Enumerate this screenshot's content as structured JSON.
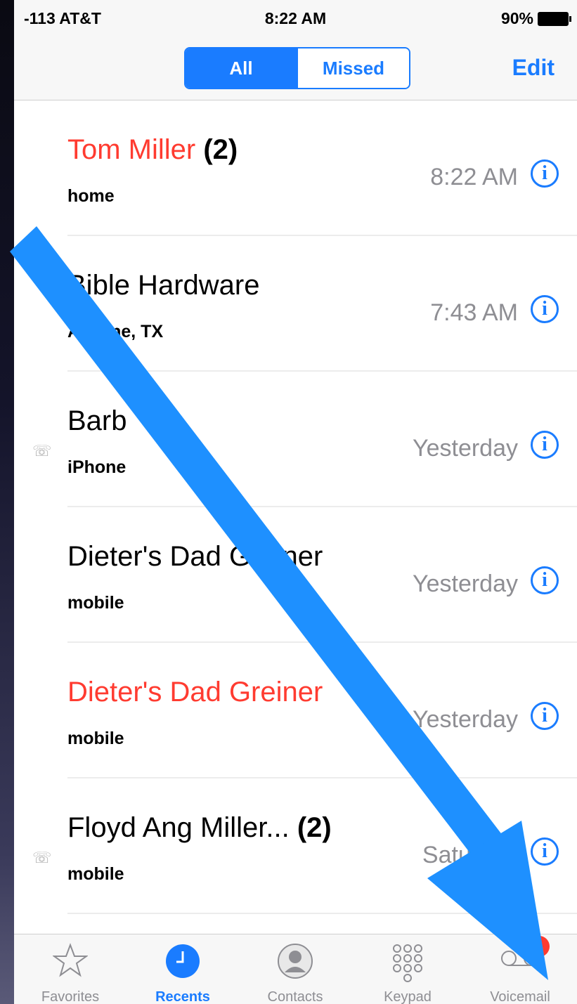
{
  "status_bar": {
    "signal": "-113 AT&T",
    "time": "8:22 AM",
    "battery": "90%"
  },
  "nav": {
    "segments": [
      "All",
      "Missed"
    ],
    "edit": "Edit"
  },
  "calls": [
    {
      "name": "Tom Miller",
      "count": "(2)",
      "sub": "home",
      "time": "8:22 AM",
      "missed": true,
      "outgoing": false
    },
    {
      "name": "Bible Hardware",
      "count": "",
      "sub": "Abilene, TX",
      "time": "7:43 AM",
      "missed": false,
      "outgoing": false
    },
    {
      "name": "Barb",
      "count": "",
      "sub": "iPhone",
      "time": "Yesterday",
      "missed": false,
      "outgoing": true
    },
    {
      "name": "Dieter's Dad Greiner",
      "count": "",
      "sub": "mobile",
      "time": "Yesterday",
      "missed": false,
      "outgoing": false
    },
    {
      "name": "Dieter's Dad Greiner",
      "count": "",
      "sub": "mobile",
      "time": "Yesterday",
      "missed": true,
      "outgoing": false
    },
    {
      "name": "Floyd Ang Miller...",
      "count": "(2)",
      "sub": "mobile",
      "time": "Saturday",
      "missed": false,
      "outgoing": true
    }
  ],
  "tabs": [
    {
      "label": "Favorites",
      "icon": "star-icon",
      "active": false
    },
    {
      "label": "Recents",
      "icon": "clock-icon",
      "active": true
    },
    {
      "label": "Contacts",
      "icon": "person-icon",
      "active": false
    },
    {
      "label": "Keypad",
      "icon": "keypad-icon",
      "active": false
    },
    {
      "label": "Voicemail",
      "icon": "voicemail-icon",
      "active": false,
      "badge": "1"
    }
  ],
  "colors": {
    "accent": "#1a7cff",
    "missed": "#ff3b30",
    "arrow": "#1e90ff"
  },
  "info_glyph": "i",
  "outgoing_glyph": "☏"
}
